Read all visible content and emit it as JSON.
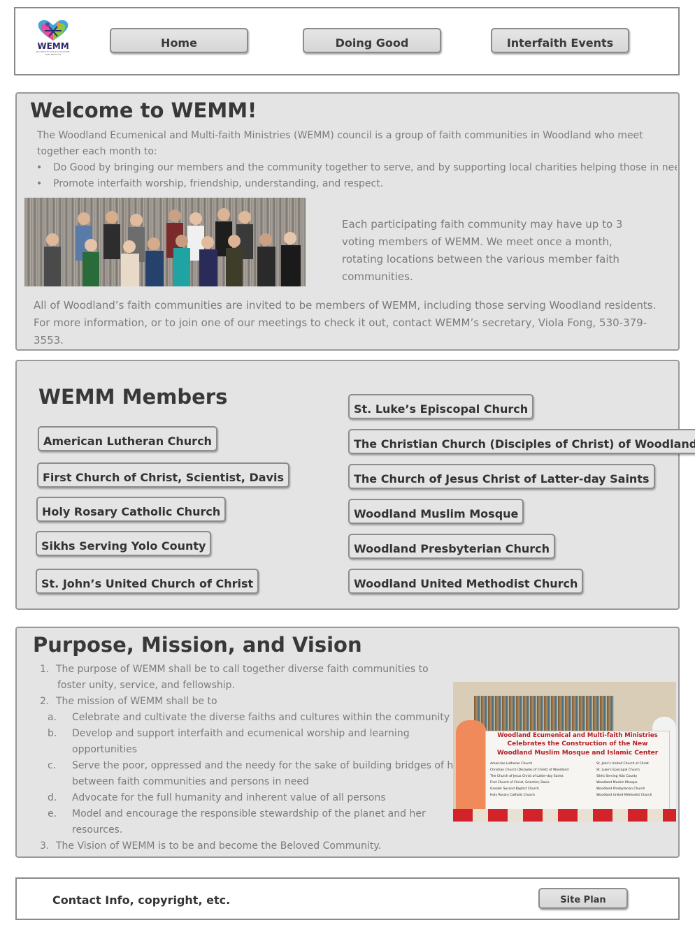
{
  "header": {
    "logo_text": "WEMM",
    "logo_subtext": "Woodland Ecumenical and Multi-Faith Ministries",
    "nav": [
      {
        "label": "Home"
      },
      {
        "label": "Doing Good"
      },
      {
        "label": "Interfaith Events"
      }
    ]
  },
  "welcome": {
    "title": "Welcome to WEMM!",
    "intro": "The Woodland Ecumenical and Multi-faith Ministries (WEMM) council is a group of faith communities in Woodland who meet together each month to:",
    "bullets": [
      "Do Good by bringing our members and the community together to serve, and by supporting local charities helping those in need, and",
      "Promote interfaith worship, friendship, understanding, and respect."
    ],
    "side_text": "Each participating faith community may have up to 3 voting members of WEMM. We meet once a month, rotating locations between the various member faith communities.",
    "bottom_text": "All of Woodland’s faith communities are invited to be members of WEMM, including those serving Woodland residents. For more information, or to join one of our meetings to check it out, contact WEMM’s secretary, Viola Fong, 530-379-3553."
  },
  "members": {
    "title": "WEMM Members",
    "left": [
      "American Lutheran Church",
      "First Church of Christ, Scientist, Davis",
      "Holy Rosary Catholic Church",
      "Sikhs Serving Yolo County",
      "St. John’s United Church of Christ"
    ],
    "right": [
      "St. Luke’s Episcopal Church",
      "The Christian Church (Disciples of Christ) of Woodland",
      "The Church of Jesus Christ of Latter-day Saints",
      "Woodland Muslim Mosque",
      "Woodland Presbyterian Church",
      "Woodland United Methodist Church"
    ]
  },
  "purpose": {
    "title": "Purpose, Mission, and Vision",
    "items": [
      {
        "marker": "1.",
        "text": "The purpose of WEMM shall be to call together diverse faith communities to",
        "cont": "foster unity, service, and fellowship."
      },
      {
        "marker": "2.",
        "text": "The mission of WEMM shall be to"
      },
      {
        "marker": "a.",
        "text": "Celebrate and cultivate the diverse faiths and cultures within the community"
      },
      {
        "marker": "b.",
        "text": "Develop and support interfaith and ecumenical worship and learning",
        "cont": "opportunities"
      },
      {
        "marker": "c.",
        "text": "Serve the poor, oppressed and the needy for the sake of building bridges of hope",
        "cont": "between faith communities and persons in need"
      },
      {
        "marker": "d.",
        "text": "Advocate for the full humanity and inherent value of all persons"
      },
      {
        "marker": "e.",
        "text": "Model and encourage the responsible stewardship of the planet and her",
        "cont": "resources."
      },
      {
        "marker": "3.",
        "text": "The Vision of WEMM is to be and become the Beloved Community."
      }
    ],
    "banner": {
      "line1": "Woodland Ecumenical and Multi-faith Ministries",
      "line2": "Celebrates the Construction of the New",
      "line3": "Woodland Muslim Mosque and Islamic Center",
      "list_left": [
        "American Lutheran Church",
        "Christian Church (Disciples of Christ) of Woodland",
        "The Church of Jesus Christ of Latter-day Saints",
        "First Church of Christ, Scientist, Davis",
        "Greater Second Baptist Church",
        "Holy Rosary Catholic Church"
      ],
      "list_right": [
        "St. John's United Church of Christ",
        "St. Luke's Episcopal Church",
        "Sikhs Serving Yolo County",
        "Woodland Muslim Mosque",
        "Woodland Presbyterian Church",
        "Woodland United Methodist Church"
      ]
    }
  },
  "footer": {
    "text": "Contact Info, copyright, etc.",
    "site_plan": "Site Plan"
  },
  "colors": {
    "panel_bg": "#e4e4e4",
    "border": "#9a9a9a",
    "heading": "#383838",
    "body_text": "#7b7b7b",
    "banner_red": "#b3202a"
  }
}
